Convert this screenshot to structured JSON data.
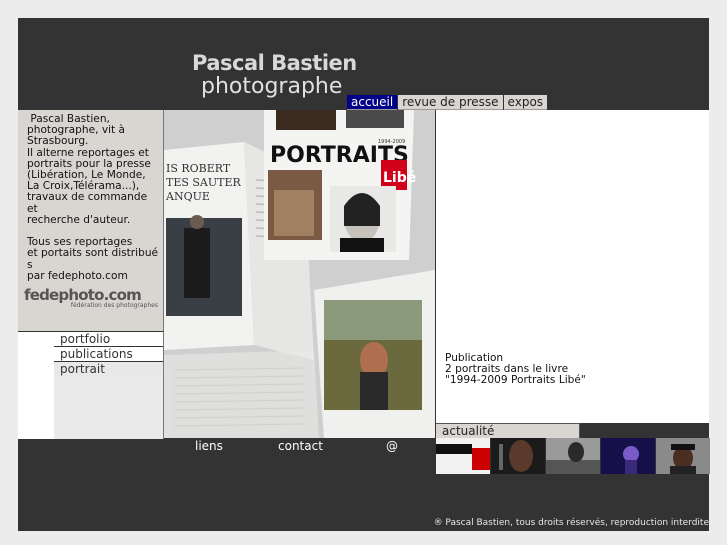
{
  "header": {
    "name": "Pascal Bastien",
    "subtitle": "photographe"
  },
  "tabs": [
    {
      "label": "accueil",
      "active": true
    },
    {
      "label": "revue de presse",
      "active": false
    },
    {
      "label": "expos",
      "active": false
    }
  ],
  "bio": {
    "text": " Pascal Bastien,\nphotographe, vit à\nStrasbourg.\nIl alterne reportages et\nportraits pour la presse\n(Libération, Le Monde,\nLa Croix,Télérama...),\ntravaux de commande et\nrecherche d'auteur.\n\nTous ses reportages\net portaits sont distribué\ns\npar fedephoto.com"
  },
  "logo": {
    "name": "fedephoto.com",
    "tagline": "fédération des photographes"
  },
  "nav": [
    "portfolio",
    "publications",
    "portrait"
  ],
  "photo": {
    "magazine_title": "PORTRAITS",
    "magazine_brand": "Libé",
    "years": "1994-2009",
    "left_page_text": "IS ROBERT",
    "left_page_text2": "TES SAUTER",
    "left_page_text3": "ANQUE"
  },
  "news": {
    "line1": "Publication",
    "line2": "2 portraits dans le livre",
    "line3": "\"1994-2009 Portraits Libé\""
  },
  "actualite_tab": "actualité",
  "bottom_nav": {
    "links": "liens",
    "contact": "contact",
    "email": "@"
  },
  "thumbnails": [
    "portraits-libe-thumb",
    "musician-thumb",
    "performer-thumb",
    "concert-thumb",
    "hat-man-thumb"
  ],
  "footer": {
    "copyright": "® Pascal Bastien, tous droits réservés, reproduction interdite"
  },
  "colors": {
    "dark": "#333333",
    "panel": "#d9d6d2",
    "active_tab": "#000088"
  }
}
